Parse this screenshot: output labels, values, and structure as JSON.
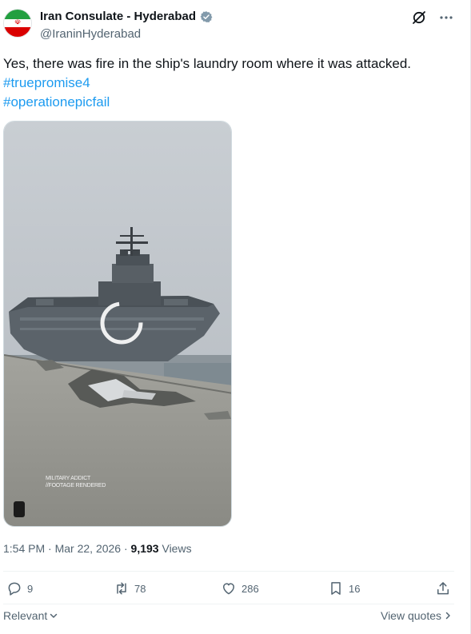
{
  "author": {
    "display_name": "Iran Consulate - Hyderabad",
    "handle": "@IraninHyderabad"
  },
  "icons": {
    "verified": "verified-badge-icon",
    "grok": "grok-icon",
    "more": "more-icon",
    "reply": "reply-icon",
    "repost": "repost-icon",
    "like": "like-icon",
    "bookmark": "bookmark-icon",
    "share": "share-icon"
  },
  "tweet": {
    "text": "Yes, there was fire in the ship's laundry room where it was attacked.",
    "hashtags": [
      "#truepromise4",
      "#operationepicfail"
    ]
  },
  "media": {
    "watermark_line1": "MILITARY ADDICT",
    "watermark_line2": "//FOOTAGE RENDERED"
  },
  "meta": {
    "time": "1:54 PM",
    "separator": " · ",
    "date": "Mar 22, 2026",
    "views_count": "9,193",
    "views_label": "Views"
  },
  "actions": {
    "replies": "9",
    "reposts": "78",
    "likes": "286",
    "bookmarks": "16"
  },
  "footer": {
    "sort_label": "Relevant",
    "quotes_label": "View quotes"
  },
  "colors": {
    "accent": "#1d9bf0",
    "text": "#0f1419",
    "secondary": "#536471"
  }
}
